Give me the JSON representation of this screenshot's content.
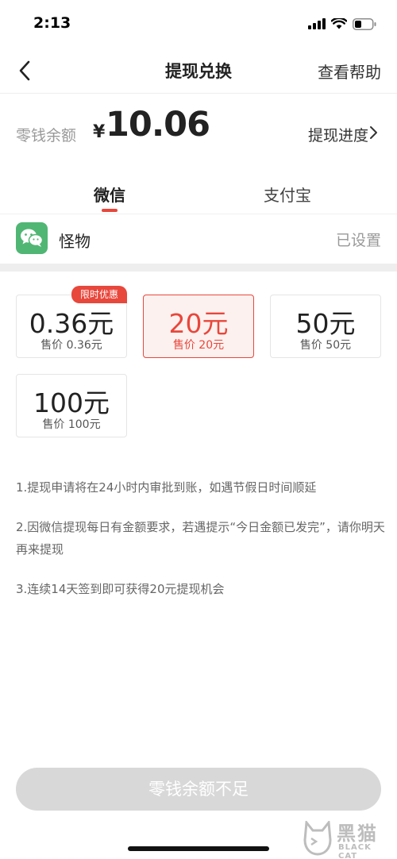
{
  "status_bar": {
    "time": "2:13"
  },
  "nav": {
    "title": "提现兑换",
    "help_label": "查看帮助"
  },
  "balance": {
    "label": "零钱余额",
    "currency": "¥",
    "amount": "10.06",
    "progress_label": "提现进度"
  },
  "tabs": [
    {
      "label": "微信",
      "active": true
    },
    {
      "label": "支付宝",
      "active": false
    }
  ],
  "account": {
    "name": "怪物",
    "status": "已设置"
  },
  "options": [
    {
      "amount": "0.36元",
      "price": "售价 0.36元",
      "badge": "限时优惠",
      "selected": false
    },
    {
      "amount": "20元",
      "price": "售价 20元",
      "selected": true
    },
    {
      "amount": "50元",
      "price": "售价 50元",
      "selected": false
    },
    {
      "amount": "100元",
      "price": "售价 100元",
      "selected": false
    }
  ],
  "notes": [
    "1.提现申请将在24小时内审批到账，如遇节假日时间顺延",
    "2.因微信提现每日有金额要求，若遇提示“今日金额已发完”，请你明天再来提现",
    "3.连续14天签到即可获得20元提现机会"
  ],
  "submit": {
    "label": "零钱余额不足",
    "enabled": false
  },
  "watermark": {
    "cn": "黑猫",
    "en": "BLACK CAT"
  },
  "colors": {
    "accent": "#e8473c",
    "wechat_green": "#50b674",
    "disabled_button": "#d8d8d8"
  }
}
